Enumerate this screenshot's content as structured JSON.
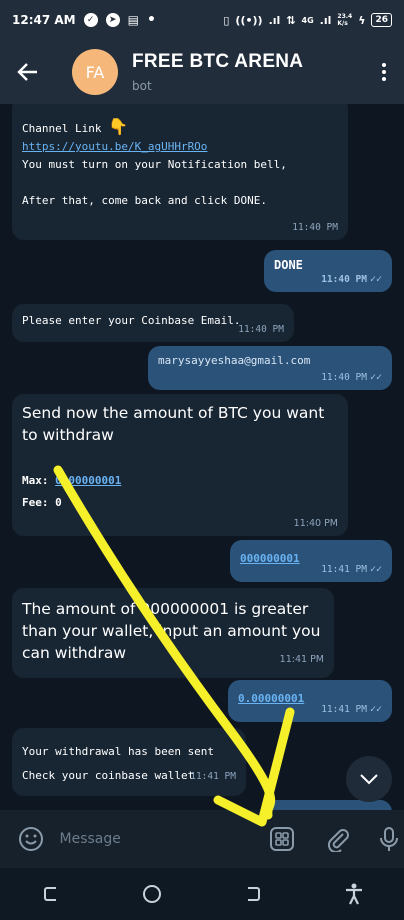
{
  "status_bar": {
    "time": "12:47 AM",
    "network": "4G",
    "speed_value": "23.4",
    "speed_unit": "K/s",
    "battery": "26"
  },
  "header": {
    "avatar_initials": "FA",
    "title": "FREE BTC ARENA",
    "subtitle": "bot"
  },
  "messages": {
    "m1": {
      "line1": "Channel Link",
      "emoji": "👇",
      "link": "https://youtu.be/K_agUHHrROo",
      "line2": "You must turn on your Notification bell,",
      "line3": "After that, come back and click DONE.",
      "time": "11:40 PM"
    },
    "m2": {
      "text": "DONE",
      "time": "11:40 PM"
    },
    "m3": {
      "text": "Please enter your Coinbase Email.",
      "time": "11:40 PM"
    },
    "m4": {
      "text": "marysayyeshaa@gmail.com",
      "time": "11:40 PM"
    },
    "m5": {
      "text": "Send now the amount of BTC you want to withdraw",
      "max_label": "Max:",
      "max_value": "0.00000001",
      "fee_label": "Fee:",
      "fee_value": "0",
      "time": "11:40 PM"
    },
    "m6": {
      "text": "000000001",
      "time": "11:41 PM"
    },
    "m7": {
      "text": "The amount of 000000001 is greater than your wallet, input an amount you can withdraw",
      "time": "11:41 PM"
    },
    "m8": {
      "text": "0.00000001",
      "time": "11:41 PM"
    },
    "m9": {
      "line1": "Your withdrawal has been sent",
      "line2": "Check your coinbase wallet",
      "time": "11:41 PM"
    }
  },
  "input": {
    "placeholder": "Message"
  },
  "colors": {
    "background": "#0e1621",
    "header": "#212d3b",
    "incoming": "#182533",
    "outgoing": "#2b5278",
    "link": "#6ab3f3",
    "annotation": "#f5f02a",
    "avatar": "#f5b87a"
  },
  "icons": {
    "back": "arrow-left-icon",
    "menu": "more-vertical-icon",
    "scroll": "chevron-down-icon",
    "emoji": "smile-icon",
    "keyboard": "bot-keyboard-icon",
    "attach": "paperclip-icon",
    "mic": "microphone-icon"
  }
}
